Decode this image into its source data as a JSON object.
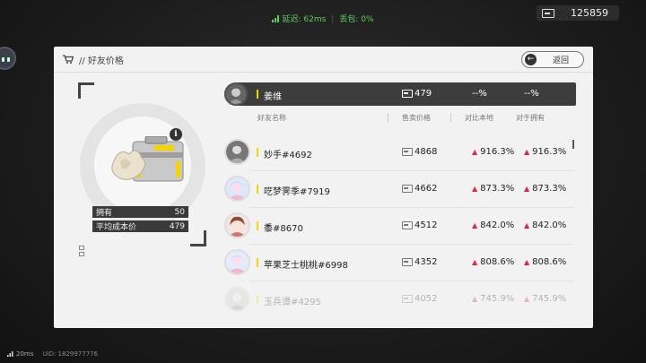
{
  "status_bar": {
    "latency": "延迟: 62ms",
    "packet_loss": "丢包: 0%"
  },
  "currency": {
    "amount": "125859",
    "icon": "banknote-icon"
  },
  "panel": {
    "title": "// 好友价格",
    "back_label": "返回",
    "icon": "cart-icon"
  },
  "item": {
    "owned_label": "拥有",
    "owned_value": "50",
    "avg_cost_label": "平均成本价",
    "avg_cost_value": "479",
    "info": "i"
  },
  "my_row": {
    "name": "姜维",
    "price": "479",
    "vs_local": "--%",
    "vs_owned": "--%"
  },
  "table": {
    "headers": {
      "name": "好友名称",
      "price": "售卖价格",
      "vs_local": "对比本地",
      "vs_owned": "对于拥有"
    },
    "rows": [
      {
        "name": "妙手#4692",
        "price": "4868",
        "vs_local": "916.3%",
        "vs_owned": "916.3%"
      },
      {
        "name": "呓梦霁季#7919",
        "price": "4662",
        "vs_local": "873.3%",
        "vs_owned": "873.3%"
      },
      {
        "name": "黍#8670",
        "price": "4512",
        "vs_local": "842.0%",
        "vs_owned": "842.0%"
      },
      {
        "name": "苹果芝士桃桃#6998",
        "price": "4352",
        "vs_local": "808.6%",
        "vs_owned": "808.6%"
      },
      {
        "name": "玉兵谭#4295",
        "price": "4052",
        "vs_local": "745.9%",
        "vs_owned": "745.9%"
      }
    ]
  },
  "footer": {
    "ping": "20ms",
    "uid": "UID: 1829977776"
  },
  "colors": {
    "accent_yellow": "#f4d400",
    "up_red": "#e0283a",
    "signal_green": "#5fcf5f"
  }
}
